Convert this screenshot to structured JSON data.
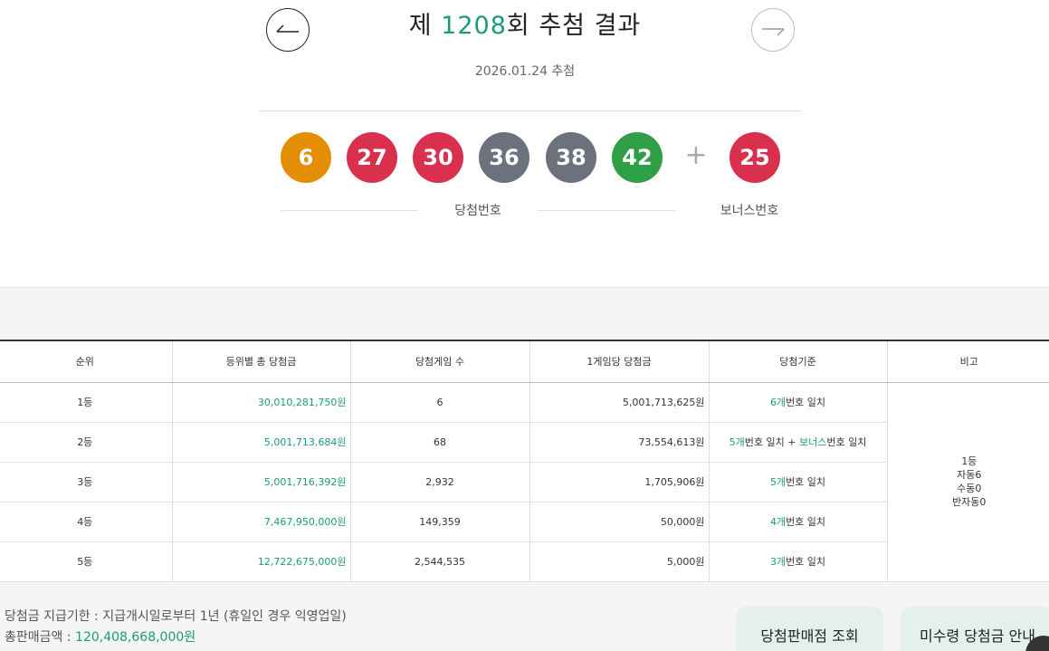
{
  "header": {
    "title_prefix": "제 ",
    "round": "1208",
    "title_suffix": "회 추첨 결과",
    "draw_date": "2026.01.24 추첨"
  },
  "balls": [
    {
      "number": "6",
      "color": "#e48e06"
    },
    {
      "number": "27",
      "color": "#d8304d"
    },
    {
      "number": "30",
      "color": "#d8304d"
    },
    {
      "number": "36",
      "color": "#6c717e"
    },
    {
      "number": "38",
      "color": "#6c717e"
    },
    {
      "number": "42",
      "color": "#2e9e47"
    }
  ],
  "plus": "+",
  "bonus": {
    "number": "25",
    "color": "#d8304d"
  },
  "captions": {
    "winning": "당첨번호",
    "bonus": "보너스번호"
  },
  "table": {
    "headers": [
      "순위",
      "등위별 총 당첨금",
      "당첨게임 수",
      "1게임당 당첨금",
      "당첨기준",
      "비고"
    ],
    "rows": [
      {
        "rank": "1등",
        "total": "30,010,281,750원",
        "games": "6",
        "per_game": "5,001,713,625원",
        "criteria": {
          "count": "6개",
          "rest": "번호 일치"
        }
      },
      {
        "rank": "2등",
        "total": "5,001,713,684원",
        "games": "68",
        "per_game": "73,554,613원",
        "criteria": {
          "count": "5개",
          "rest": "번호 일치 + ",
          "bonus": "보너스",
          "rest2": "번호 일치"
        }
      },
      {
        "rank": "3등",
        "total": "5,001,716,392원",
        "games": "2,932",
        "per_game": "1,705,906원",
        "criteria": {
          "count": "5개",
          "rest": "번호 일치"
        }
      },
      {
        "rank": "4등",
        "total": "7,467,950,000원",
        "games": "149,359",
        "per_game": "50,000원",
        "criteria": {
          "count": "4개",
          "rest": "번호 일치"
        }
      },
      {
        "rank": "5등",
        "total": "12,722,675,000원",
        "games": "2,544,535",
        "per_game": "5,000원",
        "criteria": {
          "count": "3개",
          "rest": "번호 일치"
        }
      }
    ],
    "note": [
      "1등",
      "자동6",
      "수동0",
      "반자동0"
    ]
  },
  "footer": {
    "deadline": "당첨금 지급기한 : 지급개시일로부터 1년 (휴일인 경우 익영업일)",
    "sales_label": "총판매금액 : ",
    "sales_value": "120,408,668,000원",
    "btn_stores": "당첨판매점 조회",
    "btn_unclaimed": "미수령 당첨금 안내"
  },
  "icons": {
    "prev": "arrow-left-icon",
    "next": "arrow-right-icon"
  }
}
